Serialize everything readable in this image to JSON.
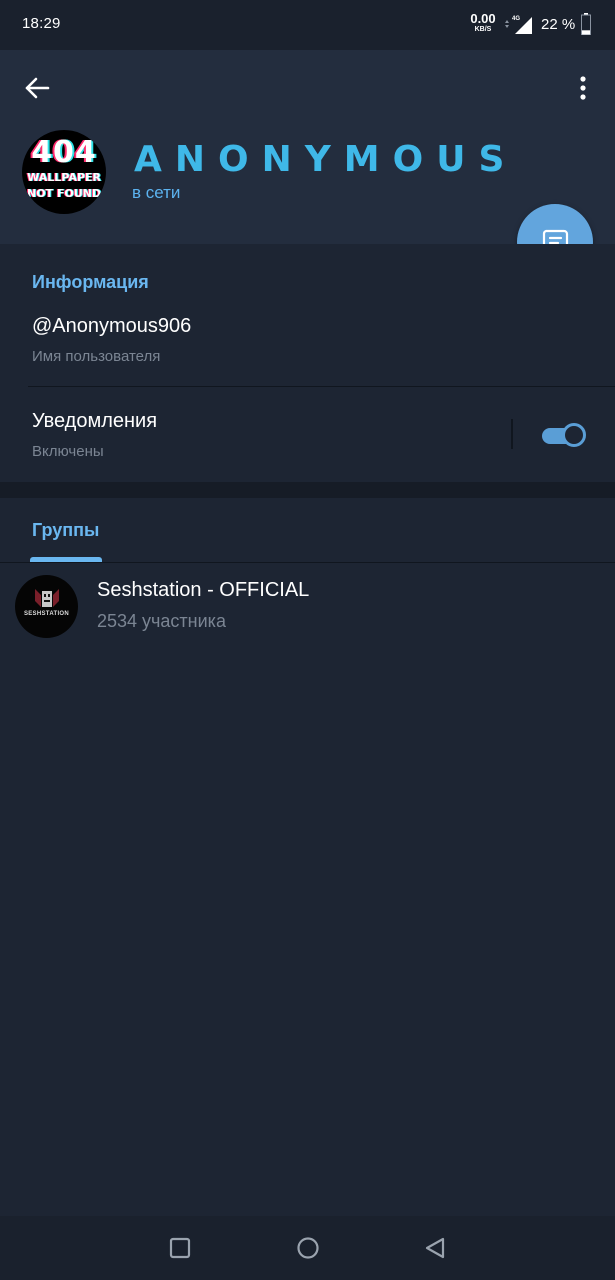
{
  "status_bar": {
    "time": "18:29",
    "net_speed_value": "0.00",
    "net_speed_unit": "KB/S",
    "network_type": "4G",
    "battery_text": "22 %",
    "battery_level": 0.22
  },
  "header": {
    "avatar_text_main": "404",
    "avatar_text_line1": "WALLPAPER",
    "avatar_text_line2": "NOT FOUND",
    "name": "ANONYMOUS",
    "status": "в сети",
    "accent_color": "#3fb8e8"
  },
  "info": {
    "section_title": "Информация",
    "username": "@Anonymous906",
    "username_label": "Имя пользователя",
    "notifications_title": "Уведомления",
    "notifications_status": "Включены",
    "notifications_enabled": true
  },
  "groups": {
    "tab_label": "Группы",
    "items": [
      {
        "name": "Seshstation - OFFICIAL",
        "members": "2534 участника",
        "avatar_text": "SESHSTATION"
      }
    ]
  },
  "icons": {
    "back": "arrow-left-icon",
    "menu": "more-vertical-icon",
    "message": "message-icon",
    "nav_recent": "square-icon",
    "nav_home": "circle-icon",
    "nav_back": "triangle-back-icon"
  }
}
